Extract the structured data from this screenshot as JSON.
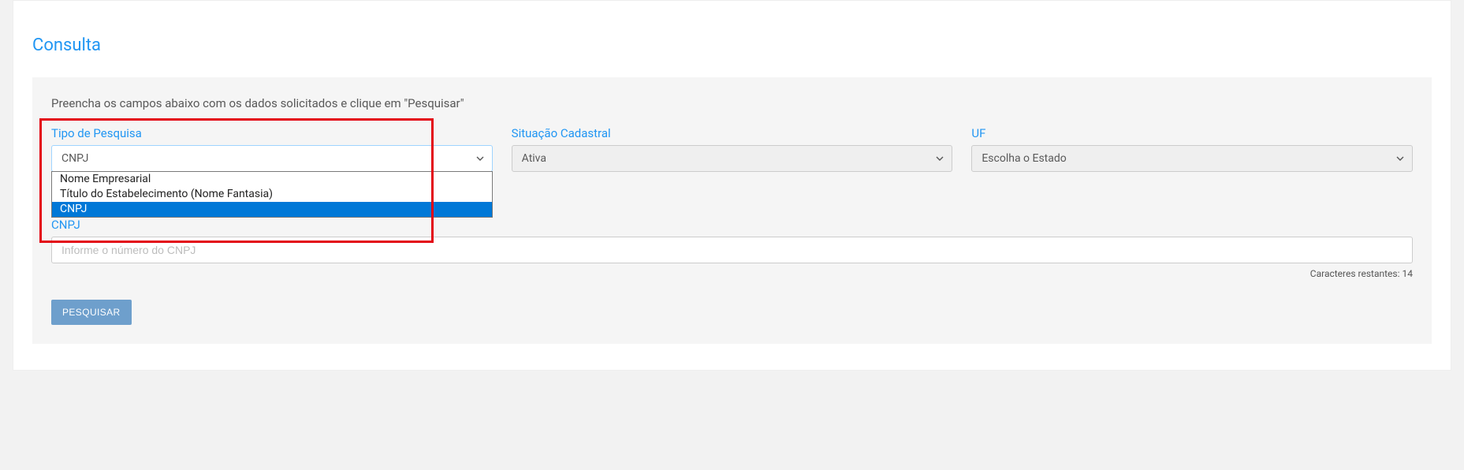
{
  "page_title": "Consulta",
  "instruction": "Preencha os campos abaixo com os dados solicitados e clique em \"Pesquisar\"",
  "tipo_pesquisa": {
    "label": "Tipo de Pesquisa",
    "selected": "CNPJ",
    "options": {
      "o1": "Nome Empresarial",
      "o2": "Título do Estabelecimento (Nome Fantasia)",
      "o3": "CNPJ"
    }
  },
  "situacao": {
    "label": "Situação Cadastral",
    "selected": "Ativa"
  },
  "uf": {
    "label": "UF",
    "selected": "Escolha o Estado"
  },
  "cnpj_field": {
    "label": "CNPJ",
    "placeholder": "Informe o número do CNPJ"
  },
  "char_counter_label": "Caracteres restantes: ",
  "char_counter_value": "14",
  "search_button": "PESQUISAR"
}
